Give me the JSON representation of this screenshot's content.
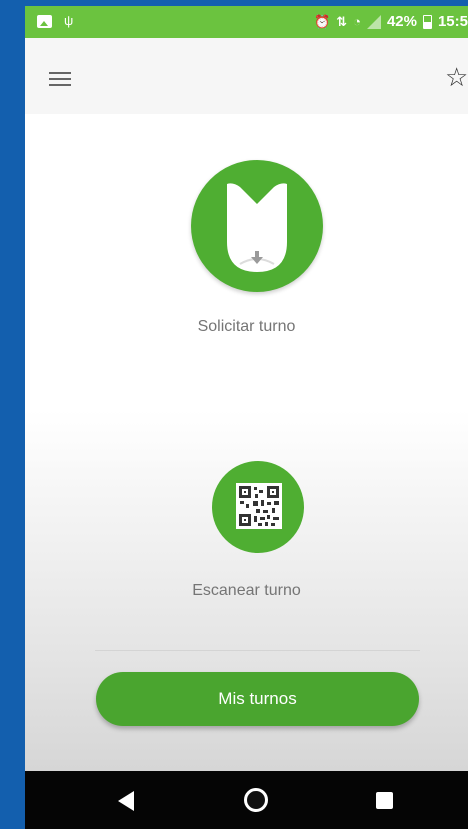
{
  "status_bar": {
    "battery_text": "42%",
    "time": "15:5",
    "icons": [
      "image-icon",
      "antenna-icon",
      "alarm-icon",
      "vibrate-icon",
      "wifi-icon",
      "signal-icon",
      "battery-icon"
    ]
  },
  "app_bar": {
    "menu_icon": "menu-icon",
    "favorite_icon": "star-outline-icon"
  },
  "actions": {
    "solicitar_label": "Solicitar turno",
    "escanear_label": "Escanear turno"
  },
  "mis_turnos_button": "Mis turnos",
  "nav_bar": {
    "icons": [
      "back-icon",
      "home-icon",
      "recents-icon"
    ]
  },
  "colors": {
    "status_bar": "#6bc33f",
    "accent_green": "#4fae32",
    "button_green": "#4aa52f",
    "frame_blue": "#1566b8"
  }
}
